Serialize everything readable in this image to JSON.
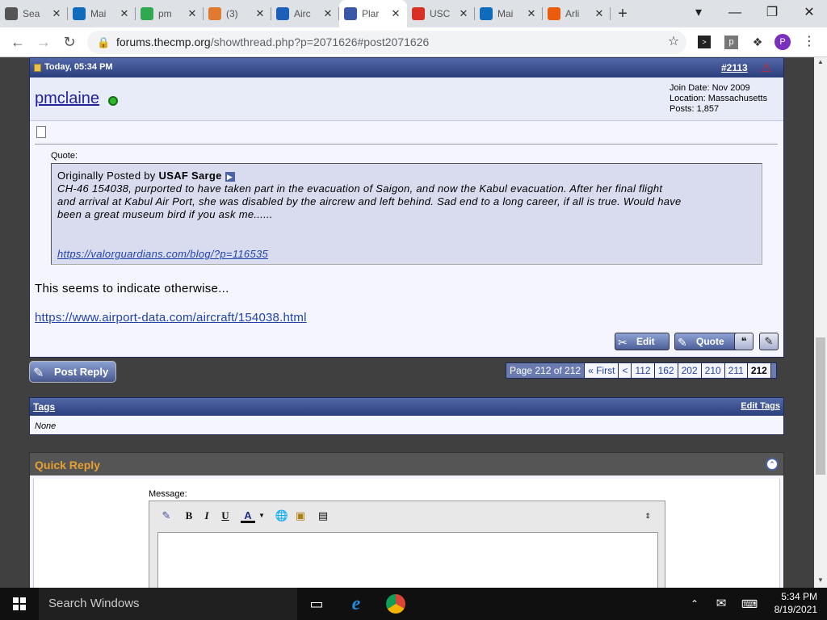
{
  "browser": {
    "tabs": [
      {
        "label": "Sea",
        "icon": "y-icon",
        "color": "#555555",
        "active": false
      },
      {
        "label": "Mai",
        "icon": "outlook-icon",
        "color": "#0f6cbd",
        "active": false
      },
      {
        "label": "pm",
        "icon": "app-icon",
        "color": "#2fa84f",
        "active": false
      },
      {
        "label": "(3)",
        "icon": "sparkle-icon",
        "color": "#e07a2e",
        "active": false
      },
      {
        "label": "Airc",
        "icon": "plane-icon",
        "color": "#1c5fb8",
        "active": false
      },
      {
        "label": "Plar",
        "icon": "forum-icon",
        "color": "#3b58a8",
        "active": true
      },
      {
        "label": "USC",
        "icon": "bag-icon",
        "color": "#d93025",
        "active": false
      },
      {
        "label": "Mai",
        "icon": "outlook-icon",
        "color": "#0f6cbd",
        "active": false
      },
      {
        "label": "Arli",
        "icon": "sun-icon",
        "color": "#ea5b0c",
        "active": false
      }
    ],
    "url_host": "forums.thecmp.org",
    "url_path": "/showthread.php?p=2071626#post2071626",
    "profile_letter": "P"
  },
  "post": {
    "date": "Today, 05:34 PM",
    "number": "#2113",
    "username": "pmclaine",
    "join_date": "Join Date: Nov 2009",
    "location": "Location: Massachusetts",
    "posts": "Posts: 1,857",
    "quote_label": "Quote:",
    "quote_prefix": "Originally Posted by",
    "quote_author": "USAF Sarge",
    "quote_line1": "CH-46 154038, purported to have taken part in the evacuation of Saigon, and now the Kabul evacuation. After her final flight",
    "quote_line2": "and arrival at Kabul Air Port, she was disabled by the aircrew and left behind. Sad end to a long career, if all is true. Would have",
    "quote_line3": "been a great museum bird if you ask me......",
    "quote_link": "https://valorguardians.com/blog/?p=116535",
    "body_text": "This seems to indicate otherwise...",
    "body_link": "https://www.airport-data.com/aircraft/154038.html",
    "edit_label": "Edit",
    "quote_button_label": "Quote"
  },
  "post_reply_label": "Post Reply",
  "pagination": {
    "info": "Page 212 of 212",
    "first": "« First",
    "prev": "<",
    "pages": [
      "112",
      "162",
      "202",
      "210",
      "211"
    ],
    "current": "212"
  },
  "tags": {
    "title": "Tags",
    "edit": "Edit Tags",
    "value": "None"
  },
  "quick_reply": {
    "title": "Quick Reply",
    "message_label": "Message:",
    "bold": "B",
    "italic": "I",
    "underline": "U",
    "font_color": "A"
  },
  "taskbar": {
    "search_placeholder": "Search Windows",
    "time": "5:34 PM",
    "date": "8/19/2021"
  }
}
